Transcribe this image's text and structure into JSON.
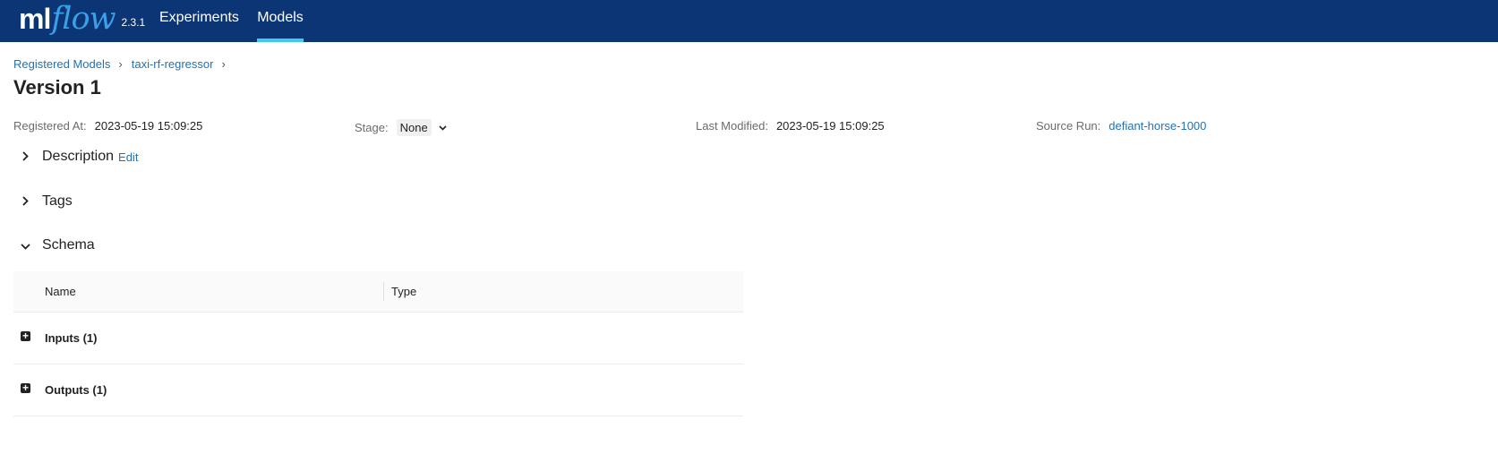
{
  "header": {
    "logo_ml": "ml",
    "logo_flow": "flow",
    "version": "2.3.1",
    "nav": [
      {
        "label": "Experiments",
        "active": false
      },
      {
        "label": "Models",
        "active": true
      }
    ],
    "bg_color": "#0b3574",
    "active_color": "#43c9ed"
  },
  "breadcrumb": {
    "items": [
      "Registered Models",
      "taxi-rf-regressor"
    ],
    "separator": "›"
  },
  "page_title": "Version 1",
  "meta": {
    "registered_at": {
      "label": "Registered At:",
      "value": "2023-05-19 15:09:25"
    },
    "stage": {
      "label": "Stage:",
      "value": "None"
    },
    "last_modified": {
      "label": "Last Modified:",
      "value": "2023-05-19 15:09:25"
    },
    "source_run": {
      "label": "Source Run:",
      "value": "defiant-horse-1000"
    }
  },
  "sections": {
    "description": {
      "title": "Description",
      "edit_label": "Edit",
      "expanded": false
    },
    "tags": {
      "title": "Tags",
      "expanded": false
    },
    "schema": {
      "title": "Schema",
      "expanded": true
    }
  },
  "schema_table": {
    "columns": [
      "Name",
      "Type"
    ],
    "rows": [
      {
        "label": "Inputs (1)"
      },
      {
        "label": "Outputs (1)"
      }
    ]
  },
  "icons": {
    "collapsed": "chevron-right-icon",
    "expanded": "chevron-down-icon",
    "row_expand": "plus-square-icon"
  }
}
